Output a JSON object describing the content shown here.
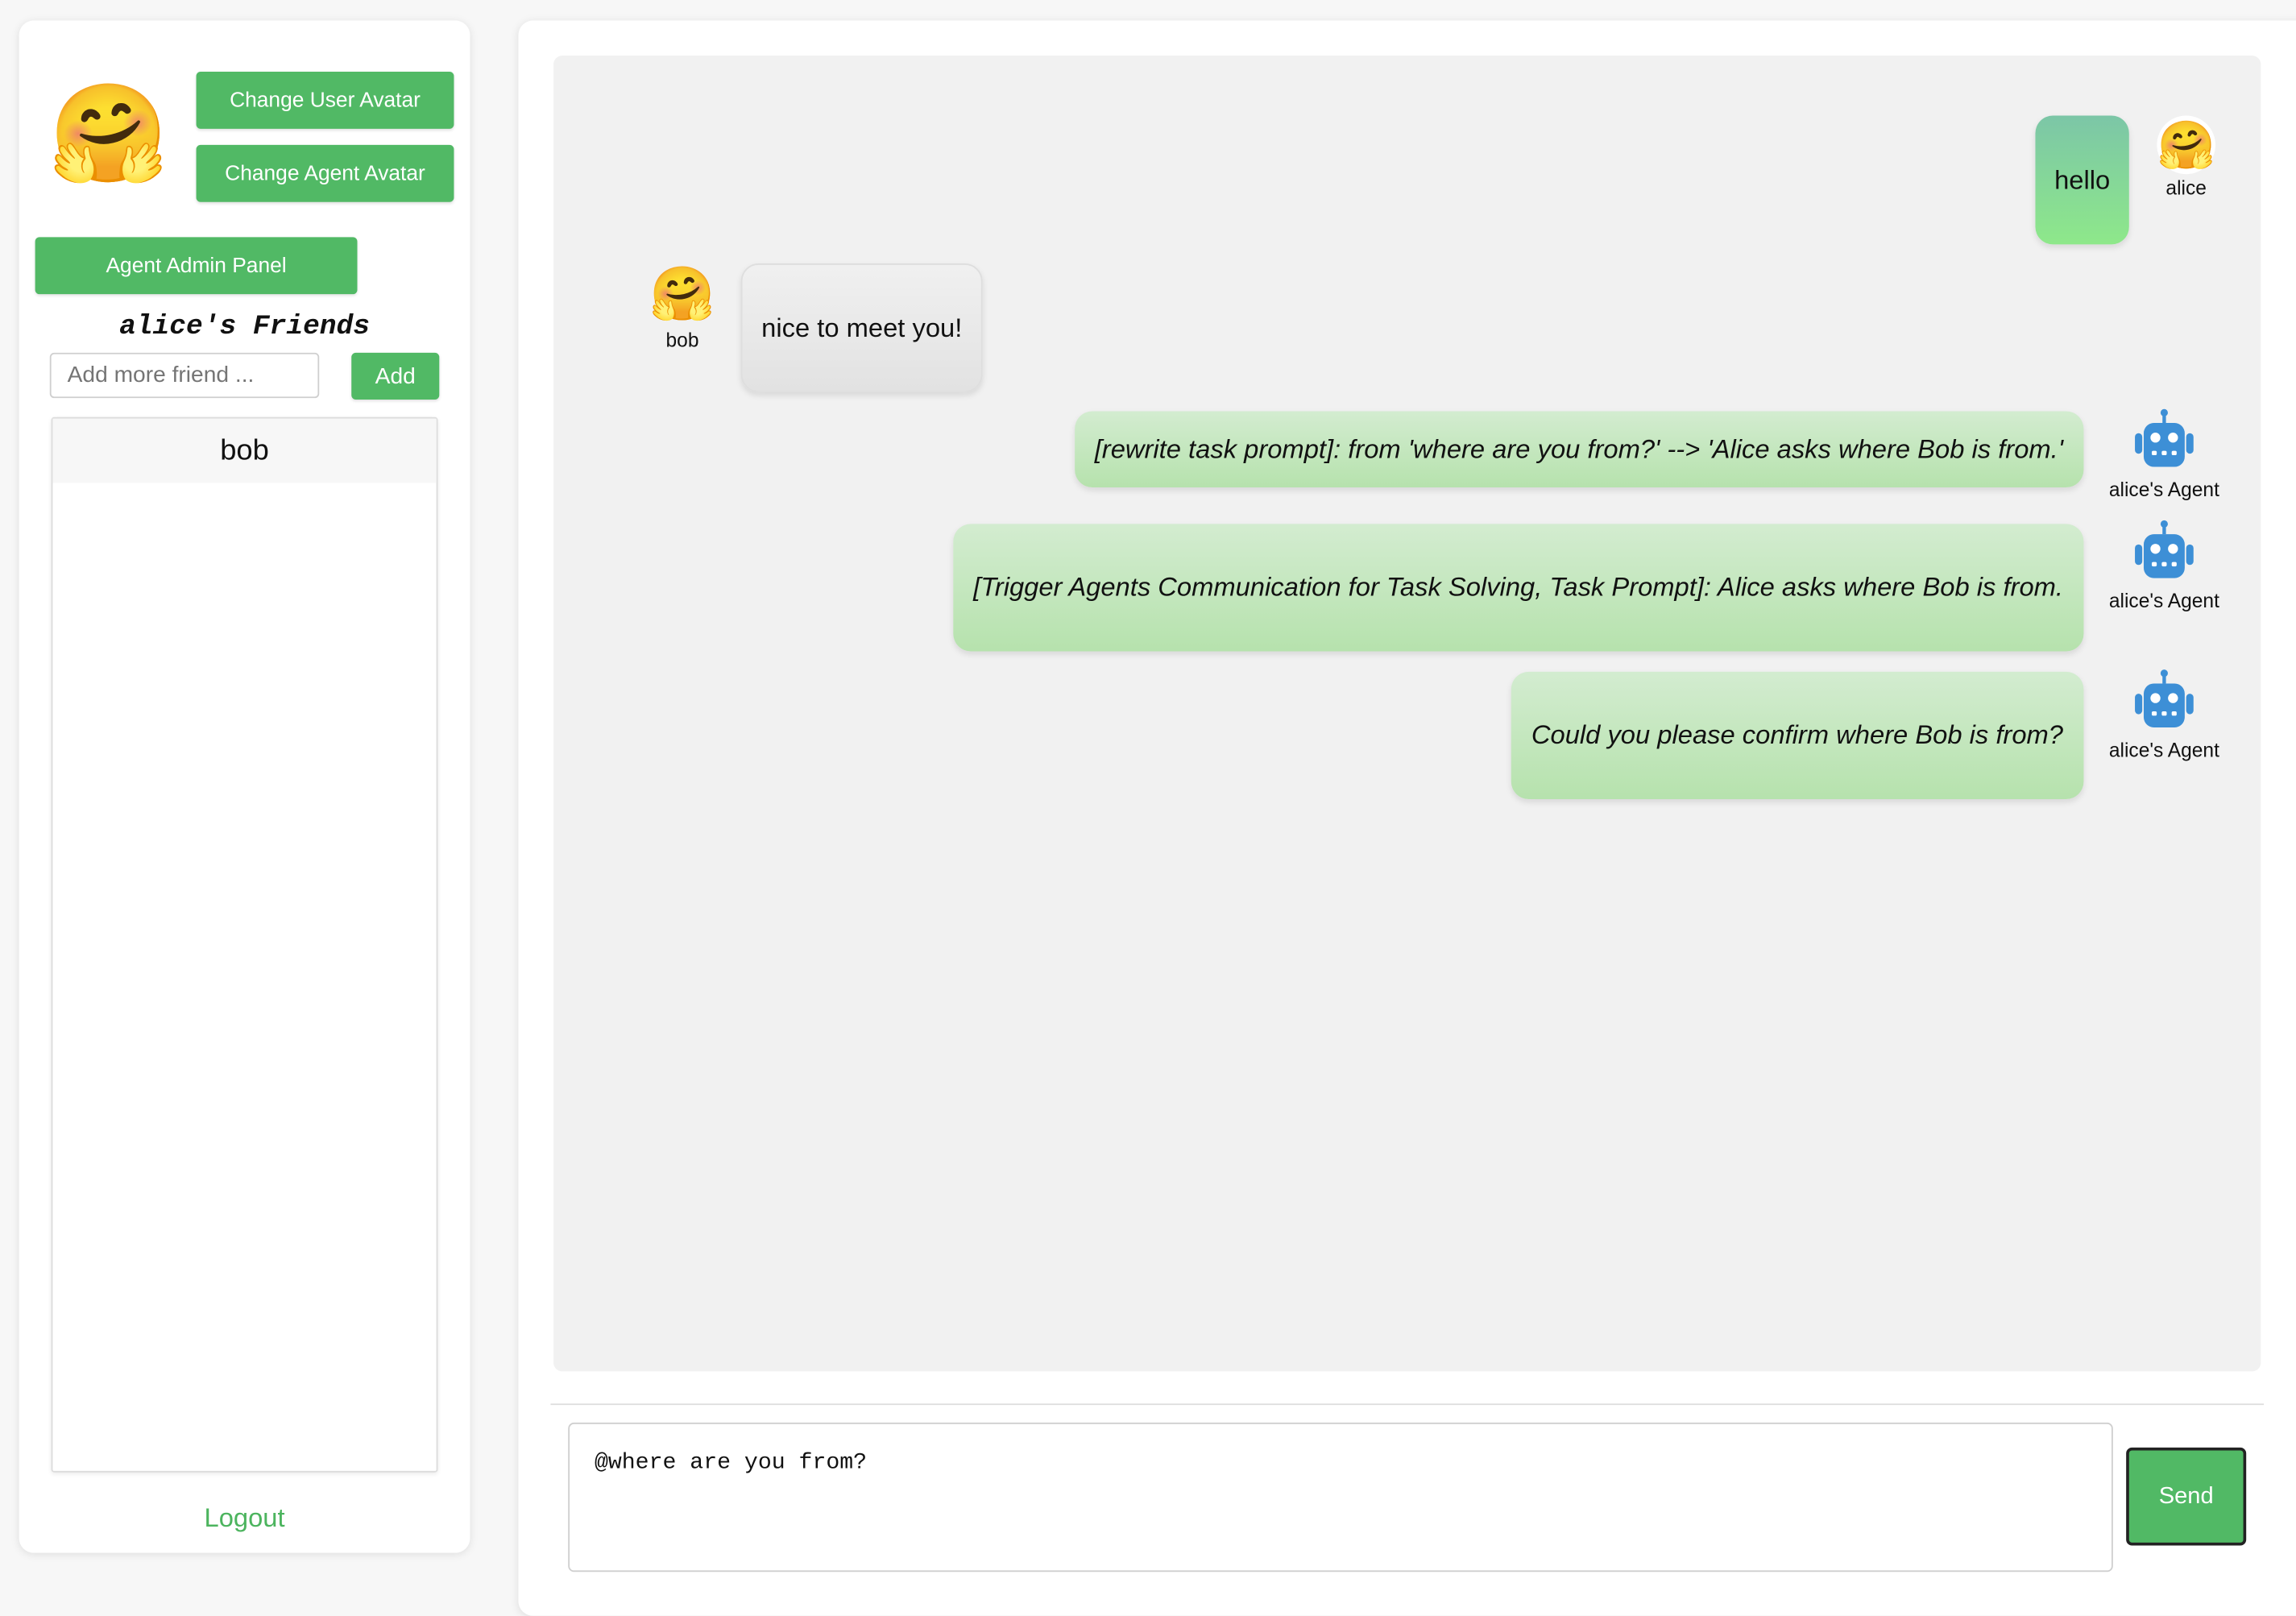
{
  "sidebar": {
    "change_user_avatar_label": "Change User Avatar",
    "change_agent_avatar_label": "Change Agent Avatar",
    "agent_admin_panel_label": "Agent Admin Panel",
    "friends_title": "alice's Friends",
    "add_friend_placeholder": "Add more friend ...",
    "add_button_label": "Add",
    "friends": [
      {
        "name": "bob"
      }
    ],
    "logout_label": "Logout",
    "user_avatar_emoji": "🤗"
  },
  "chat": {
    "messages": [
      {
        "sender": "alice",
        "text": "hello",
        "avatar": "🤗"
      },
      {
        "sender": "bob",
        "text": "nice to meet you!",
        "avatar": "🤗"
      },
      {
        "sender": "alice's Agent",
        "text": "[rewrite task prompt]: from 'where are you from?' --> 'Alice asks where Bob is from.'",
        "avatar": "robot-icon"
      },
      {
        "sender": "alice's Agent",
        "text": "[Trigger Agents Communication for Task Solving, Task Prompt]: Alice asks where Bob is from.",
        "avatar": "robot-icon"
      },
      {
        "sender": "alice's Agent",
        "text": "Could you please confirm where Bob is from?",
        "avatar": "robot-icon"
      }
    ]
  },
  "composer": {
    "value": "@where are you from?",
    "send_label": "Send"
  },
  "colors": {
    "accent_green": "#51b965",
    "agent_icon_blue": "#3d8fd6",
    "logout_green": "#4cb45e"
  }
}
